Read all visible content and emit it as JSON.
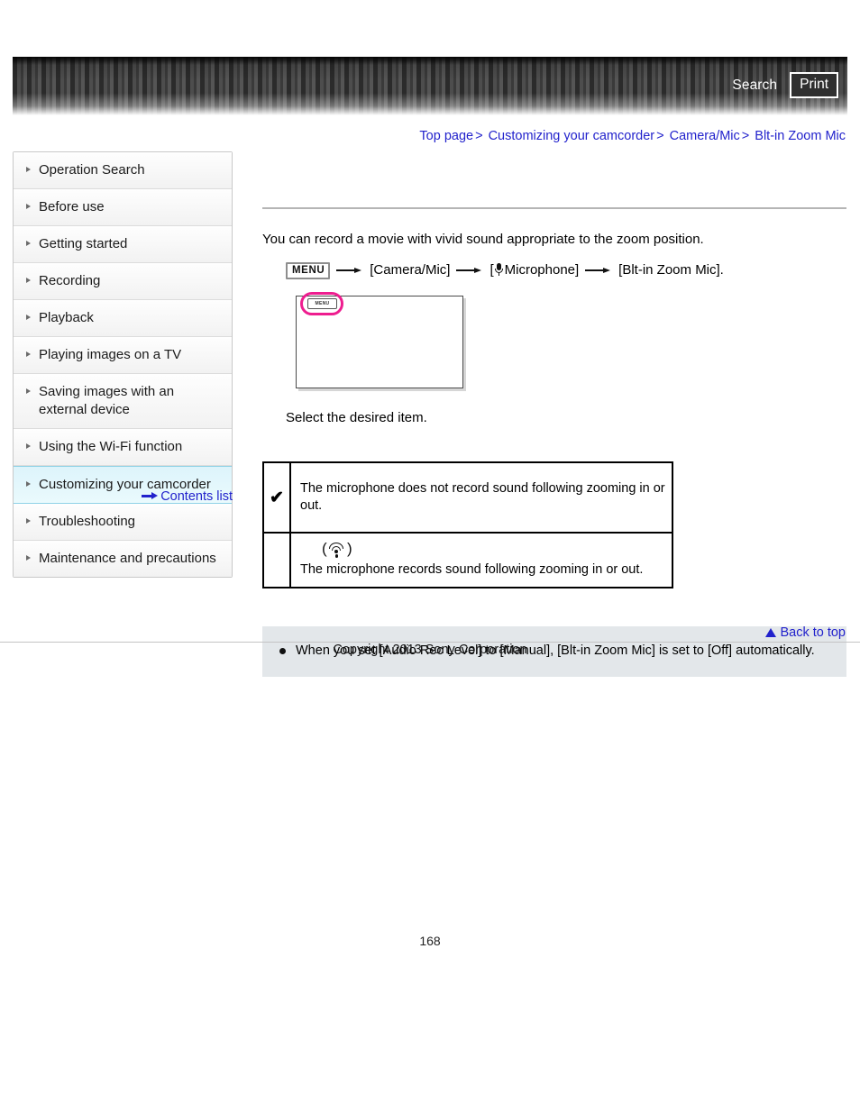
{
  "banner": {
    "search_label": "Search",
    "print_label": "Print"
  },
  "breadcrumb": {
    "items": [
      "Top page",
      "Customizing your camcorder",
      "Camera/Mic",
      "Blt-in Zoom Mic"
    ],
    "separator": ">",
    "link_color": "#2222cc"
  },
  "sidebar": {
    "items": [
      {
        "label": "Operation Search",
        "active": false
      },
      {
        "label": "Before use",
        "active": false
      },
      {
        "label": "Getting started",
        "active": false
      },
      {
        "label": "Recording",
        "active": false
      },
      {
        "label": "Playback",
        "active": false
      },
      {
        "label": "Playing images on a TV",
        "active": false
      },
      {
        "label": "Saving images with an external device",
        "active": false
      },
      {
        "label": "Using the Wi-Fi function",
        "active": false
      },
      {
        "label": "Customizing your camcorder",
        "active": true
      },
      {
        "label": "Troubleshooting",
        "active": false
      },
      {
        "label": "Maintenance and precautions",
        "active": false
      }
    ],
    "contents_list_label": "Contents list",
    "active_highlight_color": "#ddf4fb"
  },
  "main": {
    "intro": "You can record a movie with vivid sound appropriate to the zoom position.",
    "menu_path": {
      "menu_chip": "MENU",
      "seg1": "[Camera/Mic]",
      "seg2_prefix": "[",
      "seg2": "Microphone]",
      "seg3": "[Blt-in Zoom Mic]."
    },
    "illustration": {
      "menu_chip": "MENU",
      "highlight_color": "#ee1d8f"
    },
    "select_caption": "Select the desired item.",
    "options_table": {
      "rows": [
        {
          "mark": "✔",
          "icon": "",
          "description": "The microphone does not record sound following zooming in or out."
        },
        {
          "mark": "",
          "icon": "zoom-mic-icon",
          "description": "The microphone records sound following zooming in or out."
        }
      ]
    },
    "note": "When you set [Audio Rec Level] to [Manual], [Blt-in Zoom Mic] is set to [Off] automatically."
  },
  "footer": {
    "back_to_top": "Back to top",
    "copyright": "Copyright 2013 Sony Corporation",
    "page_number": "168"
  }
}
